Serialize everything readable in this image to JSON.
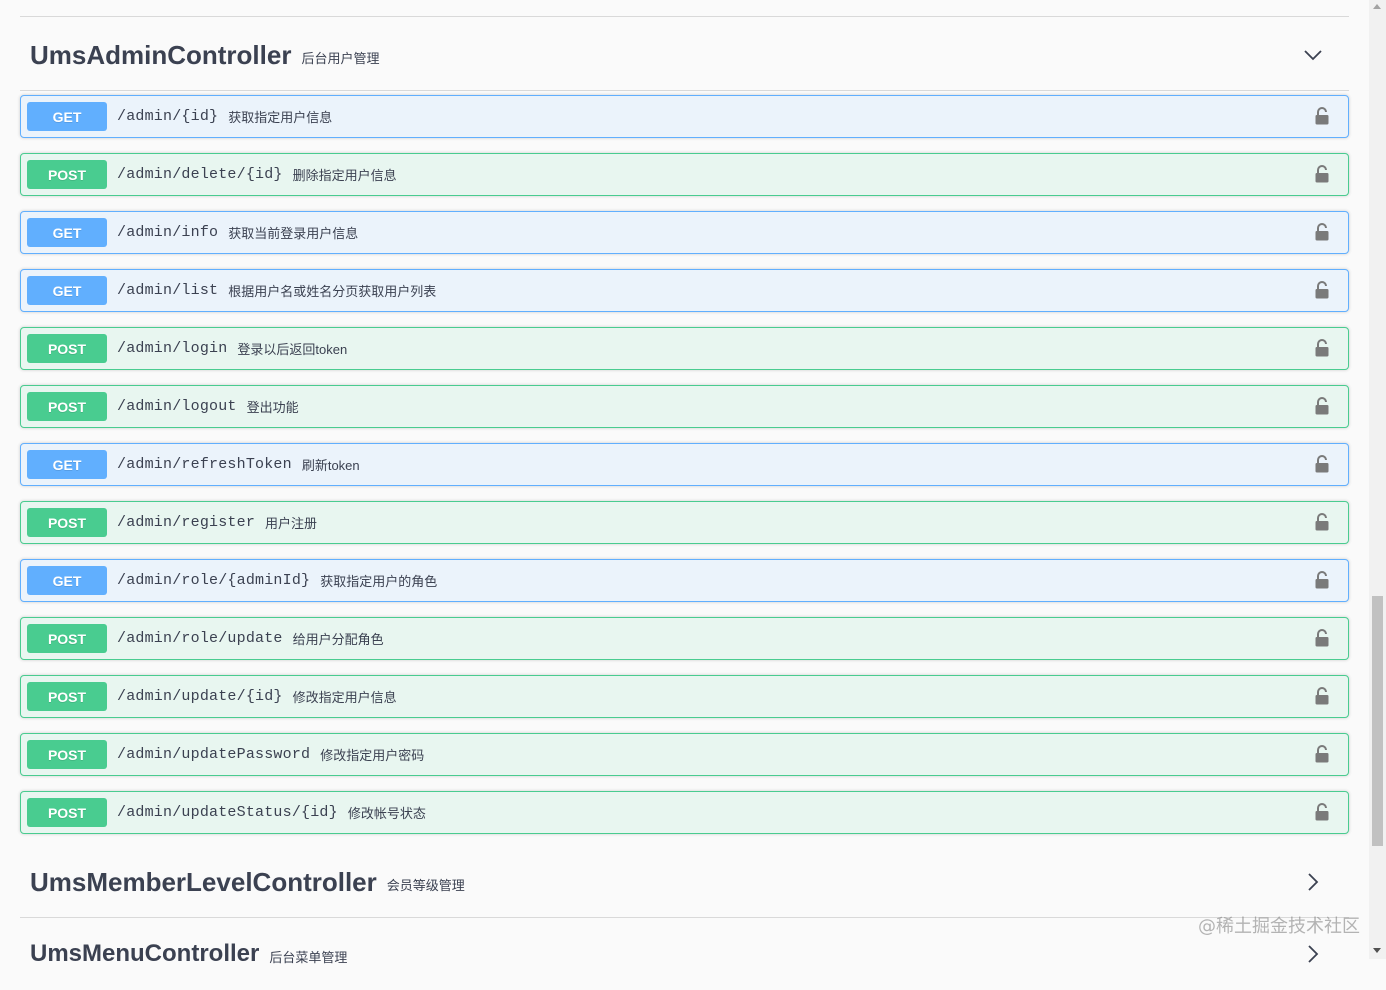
{
  "sections": [
    {
      "title": "UmsAdminController",
      "desc": "后台用户管理",
      "expanded": true,
      "chevron": "chevron-down-icon"
    },
    {
      "title": "UmsMemberLevelController",
      "desc": "会员等级管理",
      "expanded": false,
      "chevron": "chevron-right-icon"
    },
    {
      "title": "UmsMenuController",
      "desc": "后台菜单管理",
      "expanded": false,
      "chevron": "chevron-right-icon"
    }
  ],
  "operations": [
    {
      "method": "GET",
      "path": "/admin/{id}",
      "summary": "获取指定用户信息"
    },
    {
      "method": "POST",
      "path": "/admin/delete/{id}",
      "summary": "删除指定用户信息"
    },
    {
      "method": "GET",
      "path": "/admin/info",
      "summary": "获取当前登录用户信息"
    },
    {
      "method": "GET",
      "path": "/admin/list",
      "summary": "根据用户名或姓名分页获取用户列表"
    },
    {
      "method": "POST",
      "path": "/admin/login",
      "summary": "登录以后返回token"
    },
    {
      "method": "POST",
      "path": "/admin/logout",
      "summary": "登出功能"
    },
    {
      "method": "GET",
      "path": "/admin/refreshToken",
      "summary": "刷新token"
    },
    {
      "method": "POST",
      "path": "/admin/register",
      "summary": "用户注册"
    },
    {
      "method": "GET",
      "path": "/admin/role/{adminId}",
      "summary": "获取指定用户的角色"
    },
    {
      "method": "POST",
      "path": "/admin/role/update",
      "summary": "给用户分配角色"
    },
    {
      "method": "POST",
      "path": "/admin/update/{id}",
      "summary": "修改指定用户信息"
    },
    {
      "method": "POST",
      "path": "/admin/updatePassword",
      "summary": "修改指定用户密码"
    },
    {
      "method": "POST",
      "path": "/admin/updateStatus/{id}",
      "summary": "修改帐号状态"
    }
  ],
  "colors": {
    "get": "#61affe",
    "post": "#49cc90"
  },
  "watermark": "@稀土掘金技术社区"
}
